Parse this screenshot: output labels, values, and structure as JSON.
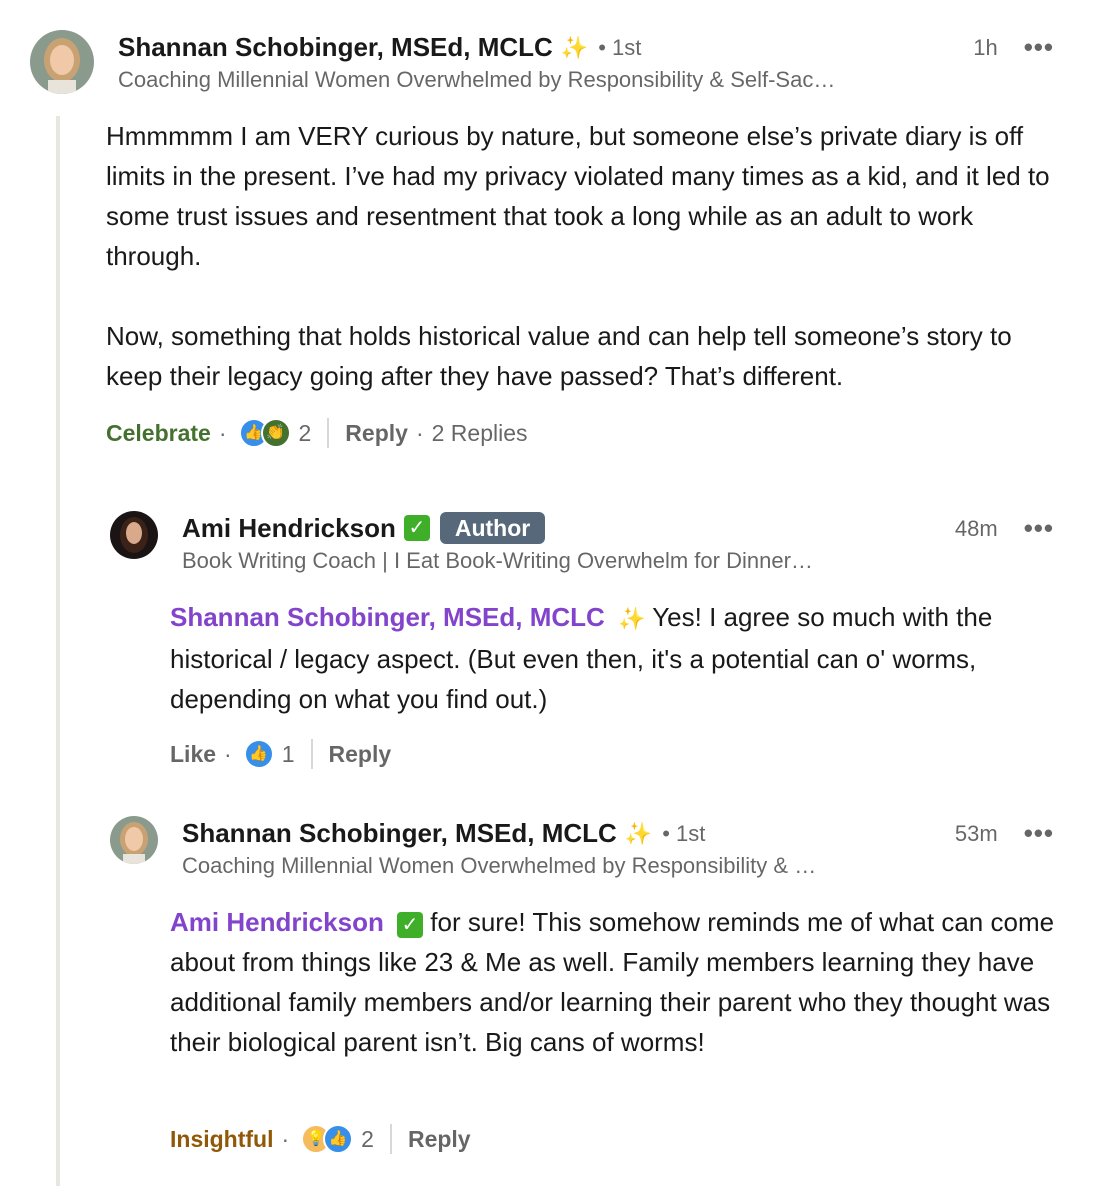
{
  "comment1": {
    "author": "Shannan Schobinger, MSEd, MCLC",
    "sparkle": "✨",
    "degree": "• 1st",
    "headline": "Coaching Millennial Women Overwhelmed by Responsibility & Self-Sac…",
    "time": "1h",
    "more": "•••",
    "body_p1": "Hmmmmm I am VERY curious by nature, but someone else’s private diary is off limits in the present. I’ve had my privacy violated many times as a kid, and it led to some trust issues and resentment that took a long while as an adult to work through.",
    "body_p2": "Now, something that holds historical value and can help tell someone’s story to keep their legacy going after they have passed? That’s different.",
    "reaction_label": "Celebrate",
    "reaction_count": "2",
    "reaction_icons": [
      "like-icon",
      "celebrate-icon"
    ],
    "reply_label": "Reply",
    "replies_label": "2 Replies",
    "dot": "·",
    "label_color": "#44712e"
  },
  "reply1": {
    "author": "Ami Hendrickson",
    "verified": "✓",
    "badge": "Author",
    "headline": "Book Writing Coach | I Eat Book-Writing Overwhelm for Dinner…",
    "time": "48m",
    "more": "•••",
    "mention": "Shannan Schobinger, MSEd, MCLC",
    "mention_sparkle": "✨",
    "body": " Yes! I agree so much with the historical / legacy aspect. (But even then, it's a potential can o' worms, depending on what you find out.)",
    "reaction_label": "Like",
    "reaction_count": "1",
    "reaction_icons": [
      "like-icon"
    ],
    "reply_label": "Reply",
    "dot": "·",
    "label_color": "#666666"
  },
  "reply2": {
    "author": "Shannan Schobinger, MSEd, MCLC",
    "sparkle": "✨",
    "degree": "• 1st",
    "headline": "Coaching Millennial Women Overwhelmed by Responsibility & …",
    "time": "53m",
    "more": "•••",
    "mention": "Ami Hendrickson",
    "mention_verified": "✓",
    "body": " for sure! This somehow reminds me of what can come about from things like 23 & Me as well. Family members learning they have additional family members and/or learning their parent who they thought was their biological parent isn’t. Big cans of worms!",
    "reaction_label": "Insightful",
    "reaction_count": "2",
    "reaction_icons": [
      "insightful-icon",
      "like-icon"
    ],
    "reply_label": "Reply",
    "dot": "·",
    "label_color": "#915907"
  }
}
